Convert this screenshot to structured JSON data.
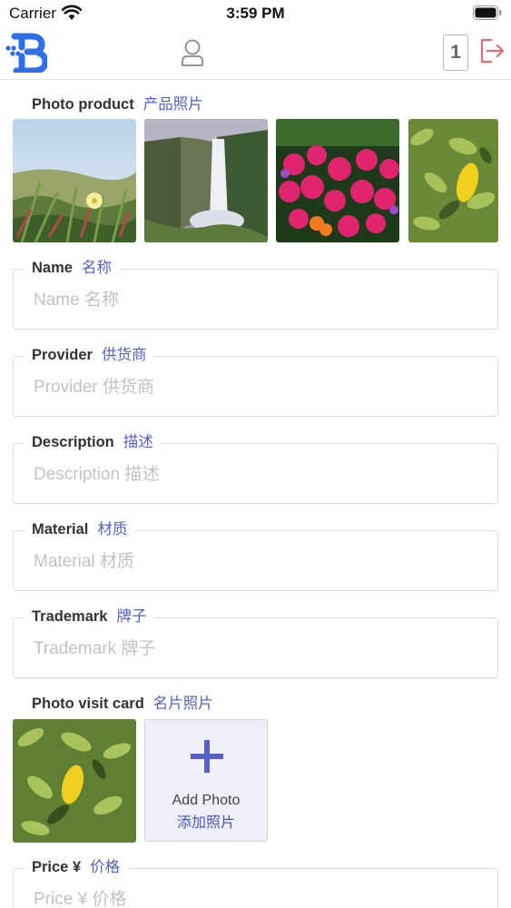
{
  "status_bar": {
    "carrier": "Carrier",
    "time": "3:59 PM"
  },
  "nav": {
    "cart_count": "1"
  },
  "photo_product": {
    "label_en": "Photo product",
    "label_zh": "产品照片"
  },
  "fields": [
    {
      "label_en": "Name",
      "label_zh": "名称",
      "placeholder": "Name 名称",
      "value": ""
    },
    {
      "label_en": "Provider",
      "label_zh": "供货商",
      "placeholder": "Provider 供货商",
      "value": ""
    },
    {
      "label_en": "Description",
      "label_zh": "描述",
      "placeholder": "Description 描述",
      "value": ""
    },
    {
      "label_en": "Material",
      "label_zh": "材质",
      "placeholder": "Material 材质",
      "value": ""
    },
    {
      "label_en": "Trademark",
      "label_zh": "牌子",
      "placeholder": "Trademark 牌子",
      "value": ""
    },
    {
      "label_en": "Price ¥",
      "label_zh": "价格",
      "placeholder": "Price ¥ 价格",
      "value": ""
    }
  ],
  "photo_visit_card": {
    "label_en": "Photo visit card",
    "label_zh": "名片照片"
  },
  "add_photo": {
    "label_en": "Add Photo",
    "label_zh": "添加照片"
  },
  "colors": {
    "accent": "#5561c9",
    "logo": "#2f6fe8",
    "logout": "#e06b7a"
  }
}
